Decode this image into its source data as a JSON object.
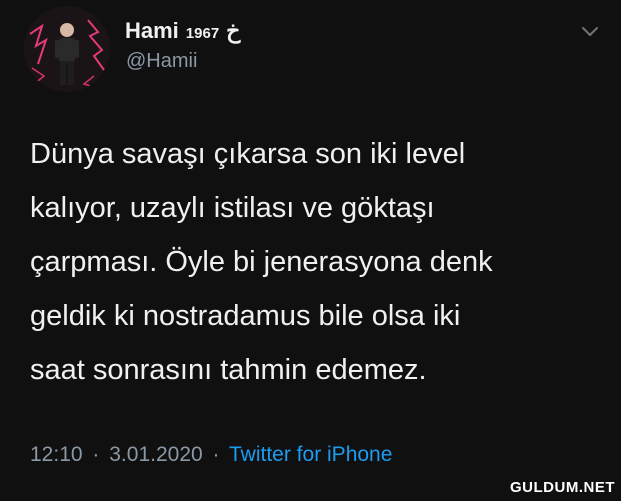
{
  "user": {
    "display_name": "Hami",
    "name_year": "1967",
    "name_glyph": "خ",
    "handle": "@Hamii"
  },
  "tweet": {
    "lines": [
      "Dünya savaşı çıkarsa son iki level",
      "kalıyor, uzaylı istilası ve göktaşı",
      "çarpması. Öyle bi jenerasyona denk",
      "geldik ki nostradamus bile olsa iki",
      "saat sonrasını tahmin edemez."
    ]
  },
  "meta": {
    "time": "12:10",
    "separator": "·",
    "date": "3.01.2020",
    "source": "Twitter for iPhone"
  },
  "icons": {
    "menu": "chevron-down-icon"
  },
  "colors": {
    "background": "#101010",
    "text": "#f0f0f0",
    "secondary": "#8b98a5",
    "link": "#1d9bf0"
  },
  "watermark": "GULDUM.NET"
}
